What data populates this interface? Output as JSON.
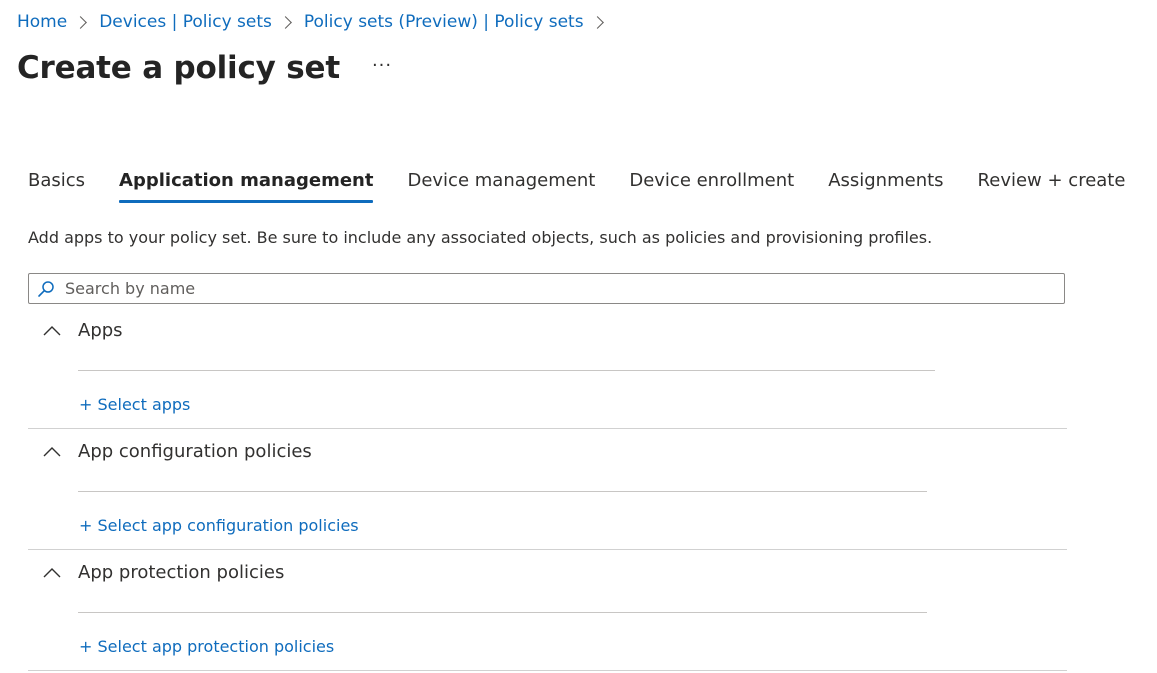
{
  "breadcrumb": [
    {
      "label": "Home"
    },
    {
      "label": "Devices | Policy sets"
    },
    {
      "label": "Policy sets (Preview) | Policy sets"
    }
  ],
  "page_title": "Create a policy set",
  "more_label": "···",
  "tabs": [
    {
      "label": "Basics",
      "active": false
    },
    {
      "label": "Application management",
      "active": true
    },
    {
      "label": "Device management",
      "active": false
    },
    {
      "label": "Device enrollment",
      "active": false
    },
    {
      "label": "Assignments",
      "active": false
    },
    {
      "label": "Review + create",
      "active": false
    }
  ],
  "description": "Add apps to your policy set. Be sure to include any associated objects, such as policies and provisioning profiles.",
  "search": {
    "placeholder": "Search by name",
    "value": ""
  },
  "sections": [
    {
      "title": "Apps",
      "link": "+ Select apps",
      "expanded": true
    },
    {
      "title": "App configuration policies",
      "link": "+ Select app configuration policies",
      "expanded": true
    },
    {
      "title": "App protection policies",
      "link": "+ Select app protection policies",
      "expanded": true
    }
  ],
  "colors": {
    "accent": "#0f6cbd",
    "text": "#323130",
    "divider": "#d1d1d1"
  },
  "icons": {
    "search": "search-icon",
    "collapse": "chevron-up-icon",
    "separator": "chevron-right-icon"
  }
}
